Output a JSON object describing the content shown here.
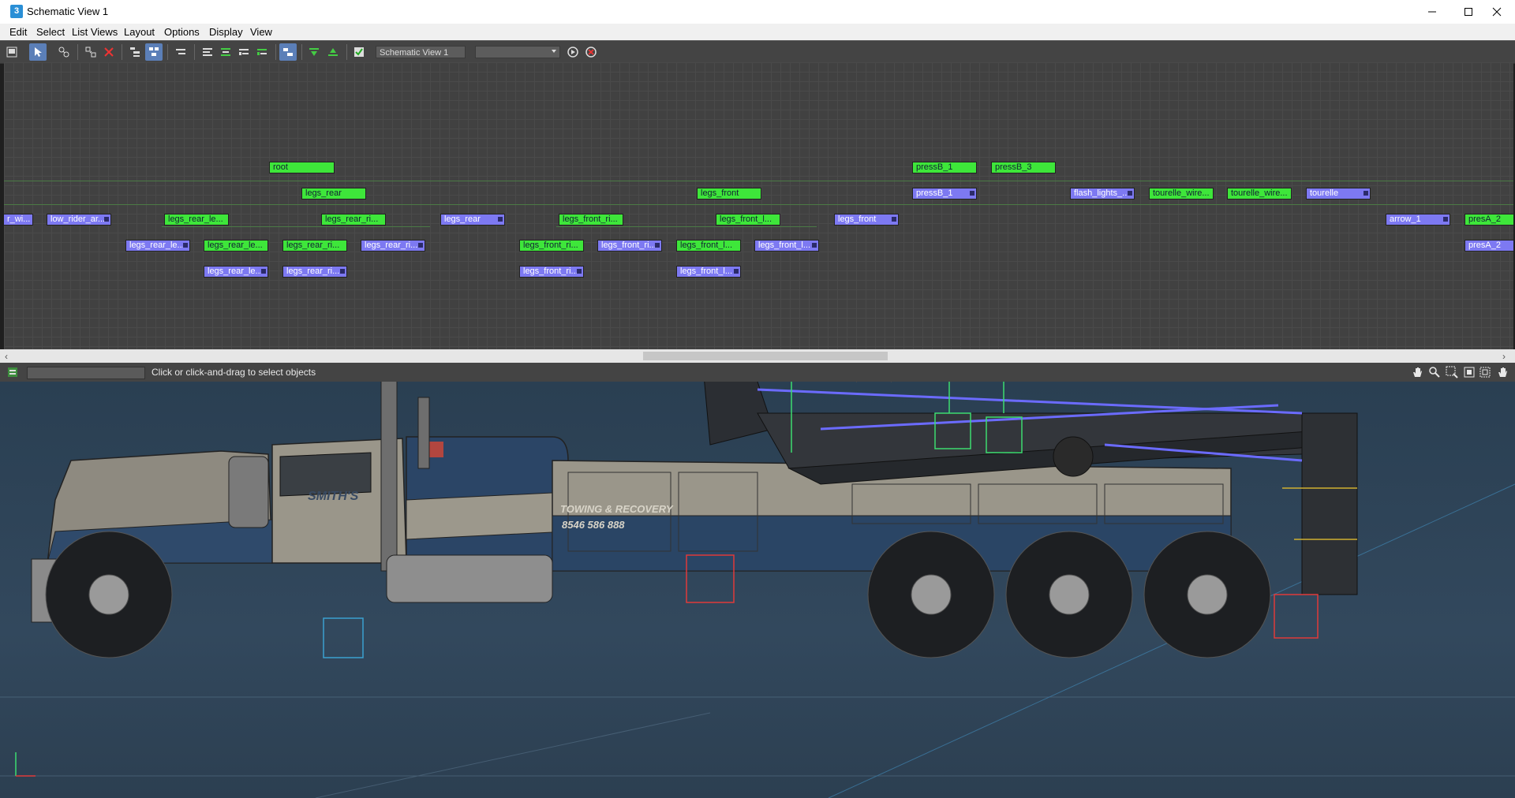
{
  "window": {
    "title": "Schematic View 1",
    "app_icon_letter": "3"
  },
  "menu": [
    "Edit",
    "Select",
    "List Views",
    "Layout",
    "Options",
    "Display",
    "View"
  ],
  "toolbar": {
    "view_name": "Schematic View 1",
    "view_select_value": ""
  },
  "schematic": {
    "nodes": [
      {
        "label": "root",
        "color": "green"
      },
      {
        "label": "pressB_1",
        "color": "green"
      },
      {
        "label": "pressB_3",
        "color": "green"
      },
      {
        "label": "legs_rear",
        "color": "green"
      },
      {
        "label": "legs_front",
        "color": "green"
      },
      {
        "label": "pressB_1",
        "color": "blue"
      },
      {
        "label": "flash_lights_...",
        "color": "blue"
      },
      {
        "label": "tourelle_wire...",
        "color": "green"
      },
      {
        "label": "tourelle_wire...",
        "color": "green"
      },
      {
        "label": "tourelle",
        "color": "blue"
      },
      {
        "label": "r_wi...",
        "color": "blue"
      },
      {
        "label": "low_rider_ar...",
        "color": "blue"
      },
      {
        "label": "legs_rear_le...",
        "color": "green"
      },
      {
        "label": "legs_rear_ri...",
        "color": "green"
      },
      {
        "label": "legs_rear",
        "color": "blue"
      },
      {
        "label": "legs_front_ri...",
        "color": "green"
      },
      {
        "label": "legs_front_l...",
        "color": "green"
      },
      {
        "label": "legs_front",
        "color": "blue"
      },
      {
        "label": "arrow_1",
        "color": "blue"
      },
      {
        "label": "presA_2",
        "color": "green"
      },
      {
        "label": "legs_rear_le...",
        "color": "blue"
      },
      {
        "label": "legs_rear_le...",
        "color": "green"
      },
      {
        "label": "legs_rear_ri...",
        "color": "green"
      },
      {
        "label": "legs_rear_ri...",
        "color": "blue"
      },
      {
        "label": "legs_front_ri...",
        "color": "green"
      },
      {
        "label": "legs_front_ri...",
        "color": "blue"
      },
      {
        "label": "legs_front_l...",
        "color": "green"
      },
      {
        "label": "legs_front_l...",
        "color": "blue"
      },
      {
        "label": "presA_2",
        "color": "blue"
      },
      {
        "label": "legs_rear_le...",
        "color": "blue"
      },
      {
        "label": "legs_rear_ri...",
        "color": "blue"
      },
      {
        "label": "legs_front_ri...",
        "color": "blue"
      },
      {
        "label": "legs_front_l...",
        "color": "blue"
      }
    ]
  },
  "status": {
    "hint": "Click or click-and-drag to select objects"
  },
  "viewport": {
    "truck_text": {
      "company": "SMITH'S",
      "service": "TOWING & RECOVERY",
      "phone": "8546 586 888"
    }
  },
  "colors": {
    "node_green": "#3ee63a",
    "node_blue": "#7d79f2",
    "canvas_bg": "#414141",
    "viewport_bg": "#2f4558"
  }
}
